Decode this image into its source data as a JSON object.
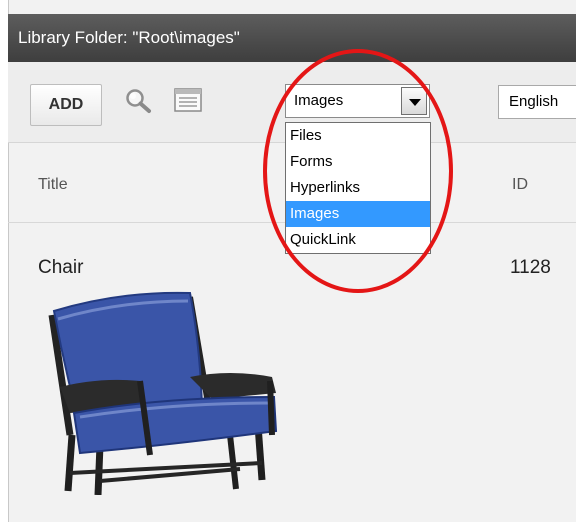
{
  "window": {
    "title": "Library Folder: \"Root\\images\""
  },
  "toolbar": {
    "add_label": "ADD",
    "search_icon": "magnifier-icon",
    "list_icon": "list-view-icon",
    "type_select": {
      "value": "Images",
      "options": [
        "Files",
        "Forms",
        "Hyperlinks",
        "Images",
        "QuickLink"
      ],
      "selected_index": 3
    },
    "language_select": {
      "value": "English"
    }
  },
  "table": {
    "headers": {
      "title": "Title",
      "id": "ID"
    },
    "rows": [
      {
        "title": "Chair",
        "id": "1128",
        "thumbnail_icon": "chair-image"
      }
    ]
  },
  "colors": {
    "titlebar": "#4a4a4a",
    "highlight": "#3399ff",
    "annotation_circle": "#e41616",
    "chair_fabric": "#3a55a8"
  }
}
